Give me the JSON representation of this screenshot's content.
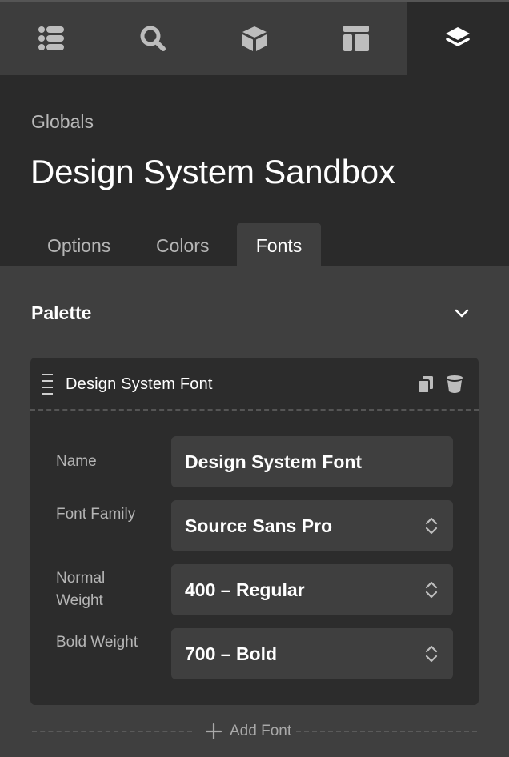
{
  "toolbar": {
    "tabs": [
      {
        "icon": "list-icon",
        "active": false
      },
      {
        "icon": "search-icon",
        "active": false
      },
      {
        "icon": "cube-icon",
        "active": false
      },
      {
        "icon": "layout-icon",
        "active": false
      },
      {
        "icon": "layers-icon",
        "active": true
      }
    ]
  },
  "header": {
    "breadcrumb": "Globals",
    "title": "Design System Sandbox"
  },
  "tabs": [
    {
      "label": "Options",
      "active": false
    },
    {
      "label": "Colors",
      "active": false
    },
    {
      "label": "Fonts",
      "active": true
    }
  ],
  "palette": {
    "title": "Palette",
    "card": {
      "title": "Design System Font",
      "actions": [
        "copy-icon",
        "trash-icon"
      ],
      "fields": [
        {
          "label": "Name",
          "value": "Design System Font",
          "type": "text"
        },
        {
          "label": "Font Family",
          "value": "Source Sans Pro",
          "type": "select"
        },
        {
          "label": "Normal Weight",
          "value": "400 – Regular",
          "type": "select"
        },
        {
          "label": "Bold Weight",
          "value": "700 – Bold",
          "type": "select"
        }
      ]
    },
    "add_label": "Add Font"
  },
  "colors": {
    "panel_dark": "#2a2a2a",
    "panel": "#3f3f3f",
    "text_muted": "#b5b5b5"
  }
}
